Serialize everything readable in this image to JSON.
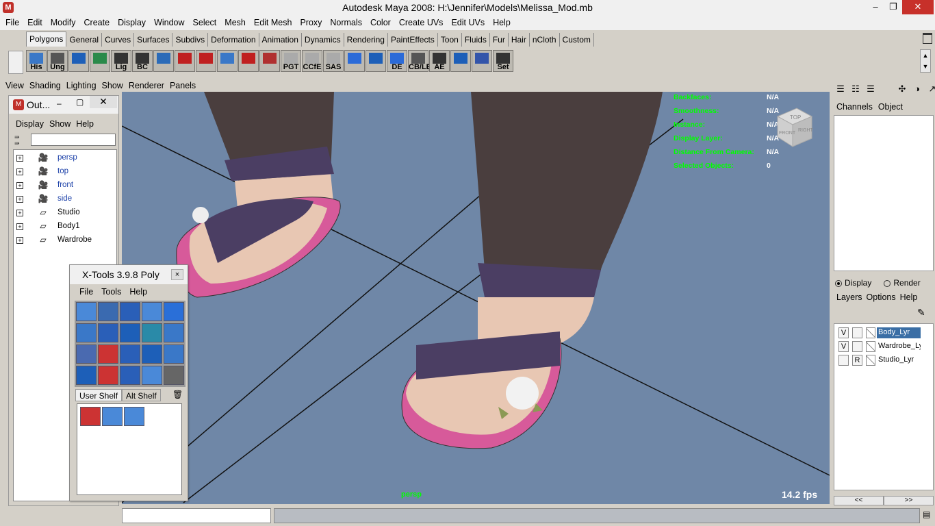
{
  "window": {
    "title": "Autodesk Maya 2008: H:\\Jennifer\\Models\\Melissa_Mod.mb",
    "minimize": "–",
    "restore": "❐",
    "close": "✕"
  },
  "menubar": [
    "File",
    "Edit",
    "Modify",
    "Create",
    "Display",
    "Window",
    "Select",
    "Mesh",
    "Edit Mesh",
    "Proxy",
    "Normals",
    "Color",
    "Create UVs",
    "Edit UVs",
    "Help"
  ],
  "shelf_tabs": [
    "Polygons",
    "General",
    "Curves",
    "Surfaces",
    "Subdivs",
    "Deformation",
    "Animation",
    "Dynamics",
    "Rendering",
    "PaintEffects",
    "Toon",
    "Fluids",
    "Fur",
    "Hair",
    "nCloth",
    "Custom"
  ],
  "shelf_icons": [
    {
      "label": "His",
      "icon": "history-icon"
    },
    {
      "label": "Ung",
      "icon": "ungroup-icon"
    },
    {
      "label": "",
      "icon": "cube-icon"
    },
    {
      "label": "",
      "icon": "sphere-icon"
    },
    {
      "label": "Lig",
      "icon": "light-icon"
    },
    {
      "label": "BC",
      "icon": "bc-icon"
    },
    {
      "label": "",
      "icon": "pivot-icon"
    },
    {
      "label": "",
      "icon": "redo-icon"
    },
    {
      "label": "",
      "icon": "extrude-icon"
    },
    {
      "label": "",
      "icon": "split-icon"
    },
    {
      "label": "",
      "icon": "axis-icon"
    },
    {
      "label": "",
      "icon": "curve-icon"
    },
    {
      "label": "PGT",
      "icon": "pgt-icon"
    },
    {
      "label": "CCfE",
      "icon": "ccfe-icon"
    },
    {
      "label": "SAS",
      "icon": "sas-icon"
    },
    {
      "label": "",
      "icon": "plane-icon"
    },
    {
      "label": "",
      "icon": "uv-grid-icon"
    },
    {
      "label": "DE",
      "icon": "de-icon"
    },
    {
      "label": "CB/LE",
      "icon": "cble-icon"
    },
    {
      "label": "AE",
      "icon": "ae-icon"
    },
    {
      "label": "",
      "icon": "bend-icon"
    },
    {
      "label": "",
      "icon": "connect-icon"
    },
    {
      "label": "Set",
      "icon": "set-key-icon"
    }
  ],
  "panel_menu": [
    "View",
    "Shading",
    "Lighting",
    "Show",
    "Renderer",
    "Panels"
  ],
  "outliner": {
    "title": "Out...",
    "min": "–",
    "max": "▢",
    "close": "✕",
    "menu": [
      "Display",
      "Show",
      "Help"
    ],
    "filter_placeholder": "",
    "items": [
      {
        "label": "persp",
        "type": "camera",
        "expand": "+"
      },
      {
        "label": "top",
        "type": "camera",
        "expand": "+"
      },
      {
        "label": "front",
        "type": "camera",
        "expand": "+"
      },
      {
        "label": "side",
        "type": "camera",
        "expand": "+"
      },
      {
        "label": "Studio",
        "type": "transform",
        "expand": "+"
      },
      {
        "label": "Body1",
        "type": "transform",
        "expand": "+"
      },
      {
        "label": "Wardrobe",
        "type": "transform",
        "expand": "+"
      }
    ]
  },
  "xtools": {
    "title": "X-Tools 3.9.8 Poly",
    "close": "×",
    "menu": [
      "File",
      "Tools",
      "Help"
    ],
    "tabs": [
      "User Shelf",
      "Alt Shelf"
    ],
    "trash": "🗑"
  },
  "viewport": {
    "hud": [
      {
        "label": "Backfaces:",
        "value": "N/A"
      },
      {
        "label": "Smoothness:",
        "value": "N/A"
      },
      {
        "label": "Instance:",
        "value": "N/A"
      },
      {
        "label": "Display Layer:",
        "value": "N/A"
      },
      {
        "label": "Distance From Camera:",
        "value": "N/A"
      },
      {
        "label": "Selected Objects:",
        "value": "0"
      }
    ],
    "fps": "14.2 fps",
    "camera": "persp",
    "viewcube": {
      "top": "TOP",
      "front": "FRONT",
      "right": "RIGHT"
    }
  },
  "channelbox": {
    "menu": [
      "Channels",
      "Object"
    ]
  },
  "layers": {
    "radio_display": "Display",
    "radio_render": "Render",
    "menu": [
      "Layers",
      "Options",
      "Help"
    ],
    "items": [
      {
        "v": "V",
        "p": "",
        "name": "Body_Lyr",
        "selected": true
      },
      {
        "v": "V",
        "p": "",
        "name": "Wardrobe_Ly",
        "selected": false
      },
      {
        "v": "",
        "p": "R",
        "name": "Studio_Lyr",
        "selected": false
      }
    ],
    "nav_prev": "<<",
    "nav_next": ">>"
  },
  "colors": {
    "accent": "#3a6ea5",
    "viewport_bg": "#6f87a7",
    "hud_green": "#00ff00"
  }
}
